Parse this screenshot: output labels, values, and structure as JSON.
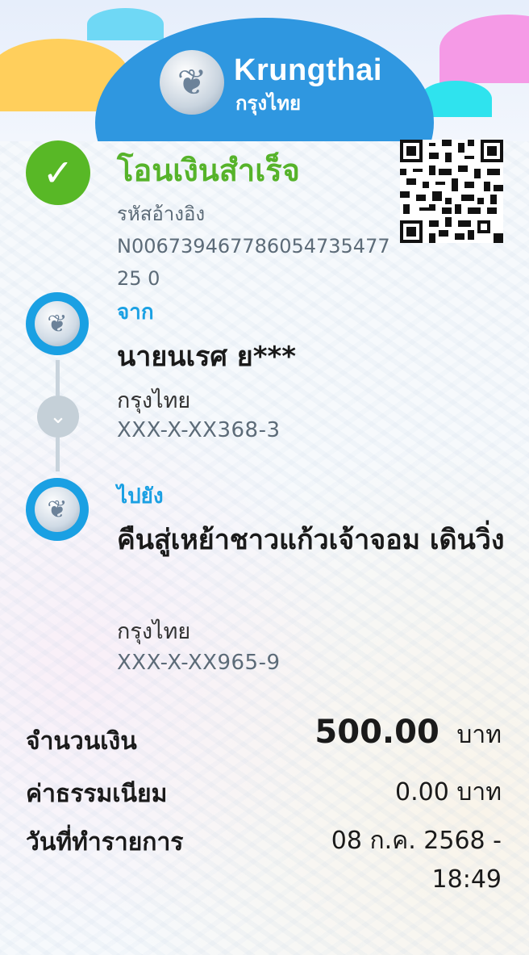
{
  "header": {
    "brand_en": "Krungthai",
    "brand_th": "กรุงไทย",
    "colors": {
      "dome": "#2f97e0",
      "success": "#56b32a",
      "accent": "#1aa0e3"
    }
  },
  "status": {
    "title": "โอนเงินสำเร็จ",
    "ref_label": "รหัสอ้างอิง",
    "ref_value": "N00673946778605473547725 0",
    "icon": "check-icon"
  },
  "from": {
    "label": "จาก",
    "name": "นายนเรศ ย***",
    "bank": "กรุงไทย",
    "account": "XXX-X-XX368-3"
  },
  "to": {
    "label": "ไปยัง",
    "name": "คืนสู่เหย้าชาวแก้วเจ้าจอม เดินวิ่ง",
    "bank": "กรุงไทย",
    "account": "XXX-X-XX965-9"
  },
  "summary": {
    "amount_label": "จำนวนเงิน",
    "amount_value": "500.00",
    "amount_unit": "บาท",
    "fee_label": "ค่าธรรมเนียม",
    "fee_value": "0.00 บาท",
    "date_label": "วันที่ทำรายการ",
    "date_value": "08 ก.ค. 2568 -",
    "time_value": "18:49"
  }
}
